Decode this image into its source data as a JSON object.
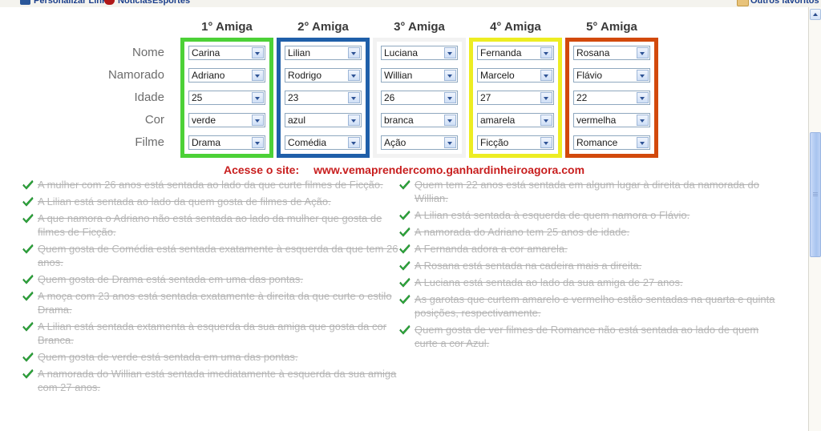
{
  "toolbar": {
    "items": [
      {
        "icon": "window-icon",
        "label": "Personalizar Links"
      },
      {
        "icon": "news-icon",
        "label": "Notícias"
      },
      {
        "icon": "sports-icon",
        "label": "Esportes"
      },
      {
        "icon": "folder-icon",
        "label": "Outros favoritos"
      }
    ]
  },
  "grid": {
    "headers": [
      "1° Amiga",
      "2° Amiga",
      "3° Amiga",
      "4° Amiga",
      "5° Amiga"
    ],
    "row_labels": [
      "Nome",
      "Namorado",
      "Idade",
      "Cor",
      "Filme"
    ],
    "columns": [
      {
        "header": "1° Amiga",
        "frame_color": "#4CD137",
        "values": [
          "Carina",
          "Adriano",
          "25",
          "verde",
          "Drama"
        ]
      },
      {
        "header": "2° Amiga",
        "frame_color": "#1F5FA9",
        "values": [
          "Lilian",
          "Rodrigo",
          "23",
          "azul",
          "Comédia"
        ]
      },
      {
        "header": "3° Amiga",
        "frame_color": "#F2F2F2",
        "values": [
          "Luciana",
          "Willian",
          "26",
          "branca",
          "Ação"
        ]
      },
      {
        "header": "4° Amiga",
        "frame_color": "#EDED22",
        "values": [
          "Fernanda",
          "Marcelo",
          "27",
          "amarela",
          "Ficção"
        ]
      },
      {
        "header": "5° Amiga",
        "frame_color": "#D2490C",
        "values": [
          "Rosana",
          "Flávio",
          "22",
          "vermelha",
          "Romance"
        ]
      }
    ]
  },
  "site_line": {
    "label": "Acesse o site:",
    "url": "www.vemaprendercomo.ganhardinheiroagora.com"
  },
  "clues": {
    "check_icon": "check-icon",
    "left": [
      "A mulher com 26 anos está sentada ao lado da que curte filmes de Ficção.",
      "A Lilian está sentada ao lado da quem gosta de filmes de Ação.",
      "A que namora o Adriano não está sentada ao lado da mulher que gosta de filmes de Ficção.",
      "Quem gosta de Comédia está sentada exatamente à esquerda da que tem 26 anos.",
      "Quem gosta de Drama está sentada em uma das pontas.",
      "A moça com 23 anos está sentada exatamente à direita da que curte o estilo Drama.",
      "A Lilian está sentada extamenta à esquerda da sua amiga que gosta da cor Branca.",
      "Quem gosta de verde está sentada em uma das pontas.",
      "A namorada do Willian está sentada imediatamente à esquerda da sua amiga com 27 anos."
    ],
    "right": [
      "Quem tem 22 anos está sentada em algum lugar à direita da namorada do Willian.",
      "A Lilian está sentada à esquerda de quem namora o Flávio.",
      "A namorada do Adriano tem 25 anos de idade.",
      "A Fernanda adora a cor amarela.",
      "A Rosana está sentada na cadeira mais a direita.",
      "A Luciana está sentada ao lado da sua amiga de 27 anos.",
      "As garotas que curtem amarelo e vermelho estão sentadas na quarta e quinta posições, respectivamente.",
      "Quem gosta de ver filmes de Romance não está sentada ao lado de quem curte a cor Azul."
    ]
  },
  "scrollbar": {
    "up_arrow": "chevron-up-icon",
    "down_arrow": "chevron-down-icon"
  }
}
